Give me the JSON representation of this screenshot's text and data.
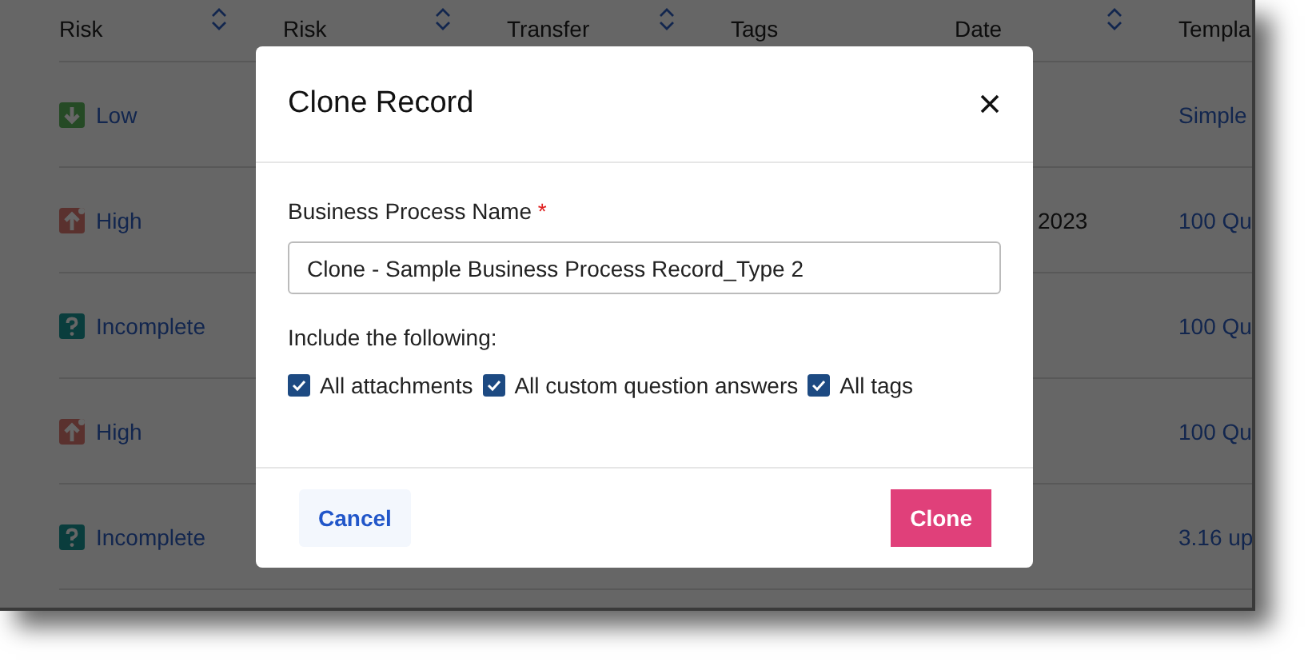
{
  "table": {
    "columns": [
      {
        "label": "Risk",
        "sortable": true
      },
      {
        "label": "Risk",
        "sortable": true
      },
      {
        "label": "Transfer",
        "sortable": true
      },
      {
        "label": "Tags",
        "sortable": false
      },
      {
        "label": "Date",
        "sortable": true
      },
      {
        "label": "Templa"
      }
    ],
    "rows": [
      {
        "inherent_risk": {
          "label": "Low",
          "kind": "low"
        },
        "revalidation_date": "",
        "template": "Simple"
      },
      {
        "inherent_risk": {
          "label": "High",
          "kind": "high"
        },
        "revalidation_date": "2023",
        "template": "100 Qu"
      },
      {
        "inherent_risk": {
          "label": "Incomplete",
          "kind": "incomplete"
        },
        "revalidation_date": "",
        "template": "100 Qu"
      },
      {
        "inherent_risk": {
          "label": "High",
          "kind": "high"
        },
        "revalidation_date": "",
        "template": "100 Qu"
      },
      {
        "inherent_risk": {
          "label": "Incomplete",
          "kind": "incomplete"
        },
        "revalidation_date": "",
        "template": "3.16 up"
      }
    ]
  },
  "dialog": {
    "title": "Clone Record",
    "field": {
      "label": "Business Process Name",
      "required_mark": "*",
      "value": "Clone - Sample Business Process Record_Type 2"
    },
    "options_label": "Include the following:",
    "options": [
      {
        "label": "All attachments",
        "checked": true
      },
      {
        "label": "All custom question answers",
        "checked": true
      },
      {
        "label": "All tags",
        "checked": true
      }
    ],
    "buttons": [
      {
        "label": "Cancel",
        "kind": "secondary"
      },
      {
        "label": "Clone",
        "kind": "primary"
      }
    ]
  }
}
